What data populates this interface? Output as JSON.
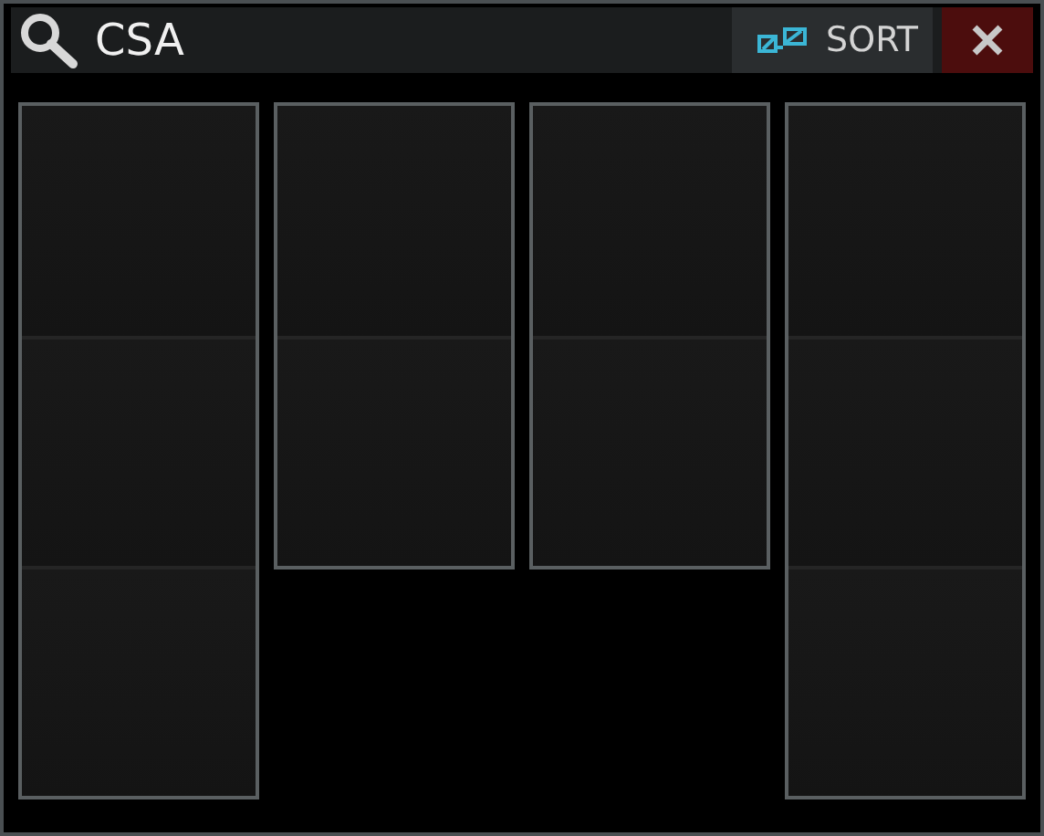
{
  "search": {
    "value": "CSA"
  },
  "sort_button": {
    "label": "SORT"
  },
  "columns": [
    {
      "slots": [
        {
          "kind": "empty"
        },
        {
          "kind": "empty"
        },
        {
          "kind": "empty"
        }
      ]
    },
    {
      "slots": [
        {
          "kind": "empty"
        },
        {
          "kind": "empty"
        }
      ]
    },
    {
      "slots": [
        {
          "kind": "empty"
        },
        {
          "kind": "empty"
        }
      ]
    },
    {
      "slots": [
        {
          "kind": "empty"
        },
        {
          "kind": "empty"
        },
        {
          "kind": "empty"
        }
      ]
    }
  ]
}
